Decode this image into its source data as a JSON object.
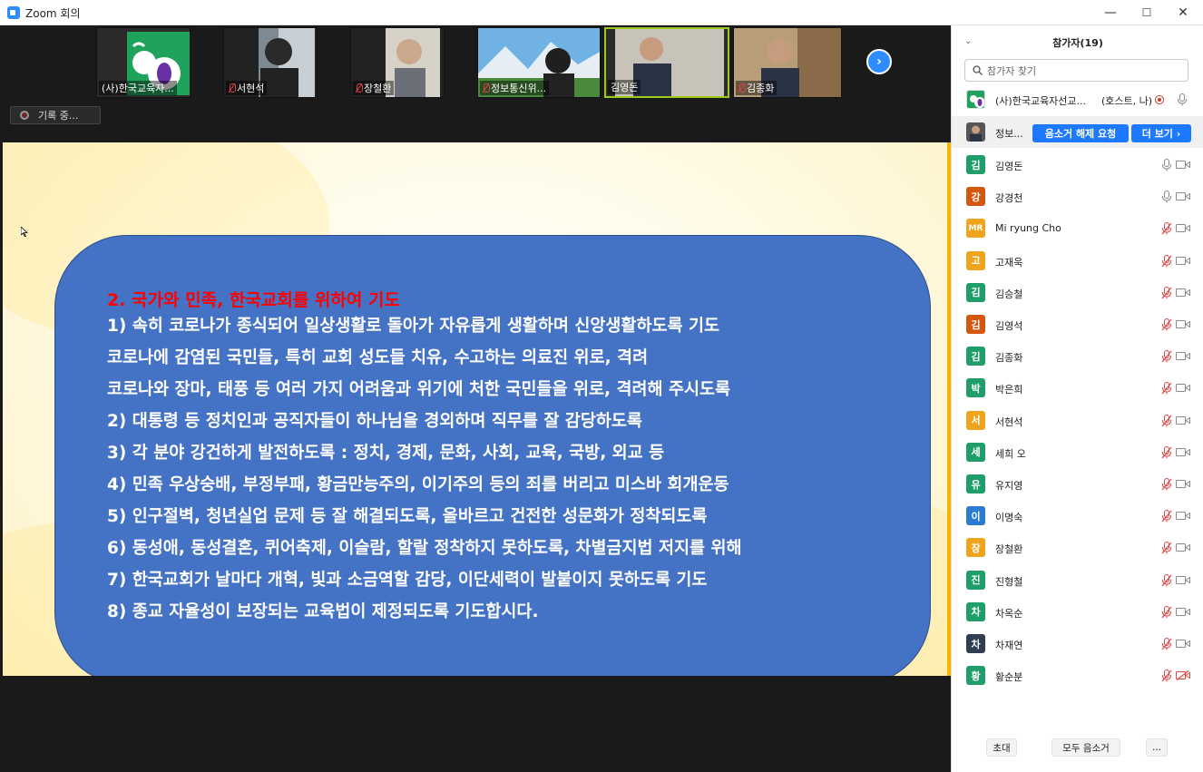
{
  "window": {
    "title": "Zoom 회의",
    "minimize": "—",
    "maximize": "☐",
    "close": "✕"
  },
  "thumbnails": [
    {
      "name": "(사)한국교육자...",
      "muted": false,
      "kind": "logo"
    },
    {
      "name": "서현석",
      "muted": true,
      "kind": "person"
    },
    {
      "name": "장철환",
      "muted": true,
      "kind": "person"
    },
    {
      "name": "정보통신위...",
      "muted": true,
      "kind": "landscape"
    },
    {
      "name": "김영돈",
      "muted": false,
      "kind": "person",
      "active": true
    },
    {
      "name": "김종화",
      "muted": true,
      "kind": "person"
    }
  ],
  "next_button": "›",
  "recording": {
    "label": "기록 중..."
  },
  "slide": {
    "heading": "2. 국가와 민족, 한국교회를 위하여 기도",
    "lines": [
      "1) 속히 코로나가 종식되어 일상생활로 돌아가 자유롭게 생활하며 신앙생활하도록 기도",
      "코로나에 감염된 국민들, 특히 교회 성도들 치유, 수고하는 의료진 위로, 격려",
      "코로나와 장마, 태풍 등 여러 가지 어려움과 위기에 처한 국민들을 위로, 격려해 주시도록",
      "2) 대통령 등 정치인과 공직자들이 하나님을 경외하며 직무를 잘 감당하도록",
      "3) 각 분야 강건하게 발전하도록 : 정치, 경제, 문화, 사회, 교육, 국방, 외교 등",
      "4) 민족 우상숭배, 부정부패, 황금만능주의, 이기주의 등의 죄를 버리고 미스바 회개운동",
      "5) 인구절벽, 청년실업 문제 등 잘 해결되도록, 올바르고 건전한 성문화가 정착되도록",
      "6) 동성애, 동성결혼, 퀴어축제, 이슬람, 할랄 정착하지 못하도록, 차별금지법 저지를 위해",
      "7) 한국교회가 날마다 개혁, 빛과 소금역할 감당, 이단세력이 발붙이지 못하도록 기도",
      "8) 종교 자율성이 보장되는 교육법이 제정되도록 기도합시다."
    ]
  },
  "participants_panel": {
    "title": "참가자(19)",
    "search_placeholder": "참가자 찾기",
    "participants": [
      {
        "avatar": "",
        "avatar_color": "#ffffff",
        "name": "(사)한국교육자선교...",
        "tag": "(호스트, 나)",
        "host": true
      },
      {
        "avatar": "",
        "avatar_color": "#555555",
        "name": "정보...",
        "selected": true,
        "unmute_request": "음소거 해제 요청",
        "more": "더 보기 ›"
      },
      {
        "avatar": "김",
        "avatar_color": "#1f9e6a",
        "name": "김영돈",
        "mic": "on",
        "cam": "on"
      },
      {
        "avatar": "강",
        "avatar_color": "#d4570f",
        "name": "강경천",
        "mic": "on",
        "cam": "on"
      },
      {
        "avatar": "MR",
        "avatar_color": "#f0a41e",
        "name": "Mi ryung Cho",
        "mic": "off",
        "cam": "on"
      },
      {
        "avatar": "고",
        "avatar_color": "#f0a41e",
        "name": "고재욱",
        "mic": "off",
        "cam": "on"
      },
      {
        "avatar": "김",
        "avatar_color": "#1f9e6a",
        "name": "김승철",
        "mic": "off",
        "cam": "on"
      },
      {
        "avatar": "김",
        "avatar_color": "#d4570f",
        "name": "김영석",
        "mic": "off",
        "cam": "on"
      },
      {
        "avatar": "김",
        "avatar_color": "#1f9e6a",
        "name": "김종화",
        "mic": "off",
        "cam": "on"
      },
      {
        "avatar": "박",
        "avatar_color": "#1f9e6a",
        "name": "박은희",
        "mic": "off",
        "cam": "on"
      },
      {
        "avatar": "서",
        "avatar_color": "#f0a41e",
        "name": "서현석",
        "mic": "off",
        "cam": "on"
      },
      {
        "avatar": "세",
        "avatar_color": "#1f9e6a",
        "name": "세희 오",
        "mic": "off",
        "cam": "on"
      },
      {
        "avatar": "유",
        "avatar_color": "#1f9e6a",
        "name": "유지영",
        "mic": "off",
        "cam": "on"
      },
      {
        "avatar": "이",
        "avatar_color": "#2b7bd0",
        "name": "이명숙",
        "mic": "off",
        "cam": "on"
      },
      {
        "avatar": "장",
        "avatar_color": "#f0a41e",
        "name": "장철환",
        "mic": "off",
        "cam": "on"
      },
      {
        "avatar": "진",
        "avatar_color": "#1f9e6a",
        "name": "진형철",
        "mic": "off",
        "cam": "on"
      },
      {
        "avatar": "차",
        "avatar_color": "#1f9e6a",
        "name": "차옥순",
        "mic": "off",
        "cam": "on"
      },
      {
        "avatar": "차",
        "avatar_color": "#2f3e52",
        "name": "차재연",
        "mic": "off",
        "cam": "on"
      },
      {
        "avatar": "황",
        "avatar_color": "#1f9e6a",
        "name": "황순분",
        "mic": "off",
        "cam": "off"
      }
    ],
    "footer": {
      "invite": "초대",
      "mute_all": "모두 음소거",
      "more": "..."
    }
  }
}
